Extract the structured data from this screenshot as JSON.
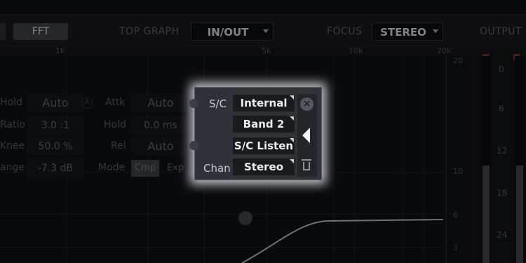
{
  "toolbar": {
    "fft_label": "FFT",
    "top_graph_label": "TOP GRAPH",
    "top_graph_value": "IN/OUT",
    "focus_label": "FOCUS",
    "focus_value": "STEREO",
    "output_label": "OUTPUT"
  },
  "graph": {
    "freq_labels": [
      "1k",
      "5k",
      "10k",
      "20k"
    ],
    "db_scale_labels": [
      "20",
      "10",
      "6",
      "3"
    ]
  },
  "output_meter": {
    "scale_labels": [
      "0",
      "6",
      "12",
      "18",
      "24"
    ]
  },
  "params": {
    "hold_label": "Hold",
    "hold_value": "Auto",
    "ratio_label": "Ratio",
    "ratio_value": "3.0 :1",
    "knee_label": "Knee",
    "knee_value": "50.0 %",
    "range_label": "ange",
    "range_value": "-7.3 dB",
    "attk_label": "Attk",
    "attk_value": "Auto",
    "hold2_label": "Hold",
    "hold2_value": "0.0 ms",
    "rel_label": "Rel",
    "rel_value": "Auto",
    "mode_label": "Mode",
    "mode_cmp": "Cmp",
    "mode_exp": "Exp",
    "knob_a": "A"
  },
  "sidechain_popup": {
    "sc_label": "S/C",
    "chan_label": "Chan",
    "source_value": "Internal",
    "band_value": "Band 2",
    "listen_label": "S/C Listen",
    "chan_value": "Stereo",
    "close_symbol": "×"
  }
}
